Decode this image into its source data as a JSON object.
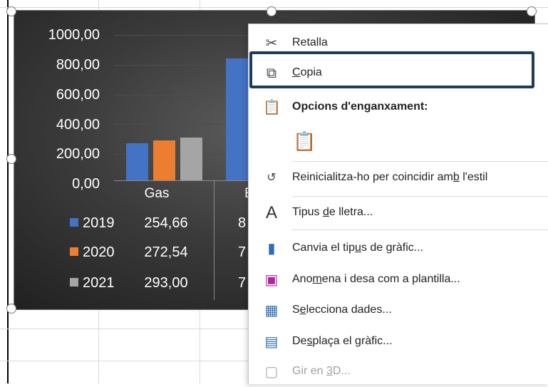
{
  "chart": {
    "y_axis_labels": [
      "1000,00",
      "800,00",
      "600,00",
      "400,00",
      "200,00",
      "0,00"
    ],
    "category_label_visible": "Gas",
    "category_label_cut": "E",
    "legend": [
      {
        "year": "2019",
        "color": "#4472c4",
        "gas": "254,66",
        "cut": "8"
      },
      {
        "year": "2020",
        "color": "#ed7d31",
        "gas": "272,54",
        "cut": "7"
      },
      {
        "year": "2021",
        "color": "#a5a5a5",
        "gas": "293,00",
        "cut": "7"
      }
    ]
  },
  "chart_data": {
    "type": "bar",
    "categories": [
      "Gas",
      "E"
    ],
    "series": [
      {
        "name": "2019",
        "values": [
          254.66,
          840
        ]
      },
      {
        "name": "2020",
        "values": [
          272.54,
          null
        ]
      },
      {
        "name": "2021",
        "values": [
          293.0,
          null
        ]
      }
    ],
    "ylim": [
      0,
      1000
    ],
    "y_ticks": [
      "0,00",
      "200,00",
      "400,00",
      "600,00",
      "800,00",
      "1000,00"
    ],
    "data_table": true
  },
  "menu": {
    "cut": {
      "pre": "Retalla",
      "icon": "scissors-icon"
    },
    "copy": {
      "pre": "",
      "u": "C",
      "post": "opia",
      "icon": "copy-icon"
    },
    "paste_options": {
      "label": "Opcions d'enganxament:",
      "icon": "clipboard-icon"
    },
    "reset": {
      "pre": "Reinicialitza-ho per coincidir am",
      "u": "b",
      "post": " l'estil",
      "icon": "reset-style-icon"
    },
    "font": {
      "pre": "Tipus ",
      "u": "d",
      "post": "e lletra...",
      "icon": "font-icon"
    },
    "change_type": {
      "pre": "Canvia el tip",
      "u": "u",
      "post": "s de gràfic...",
      "icon": "chart-type-icon"
    },
    "save_template": {
      "pre": "Ano",
      "u": "m",
      "post": "ena i desa com a plantilla...",
      "icon": "save-template-icon"
    },
    "select_data": {
      "pre": "S",
      "u": "e",
      "post": "lecciona dades...",
      "icon": "select-data-icon"
    },
    "move_chart": {
      "pre": "De",
      "u": "s",
      "post": "plaça el gràfic...",
      "icon": "move-chart-icon"
    },
    "rotate3d": {
      "pre": "Gir en ",
      "u": "3",
      "post": "D...",
      "icon": "rotate-3d-icon"
    }
  }
}
